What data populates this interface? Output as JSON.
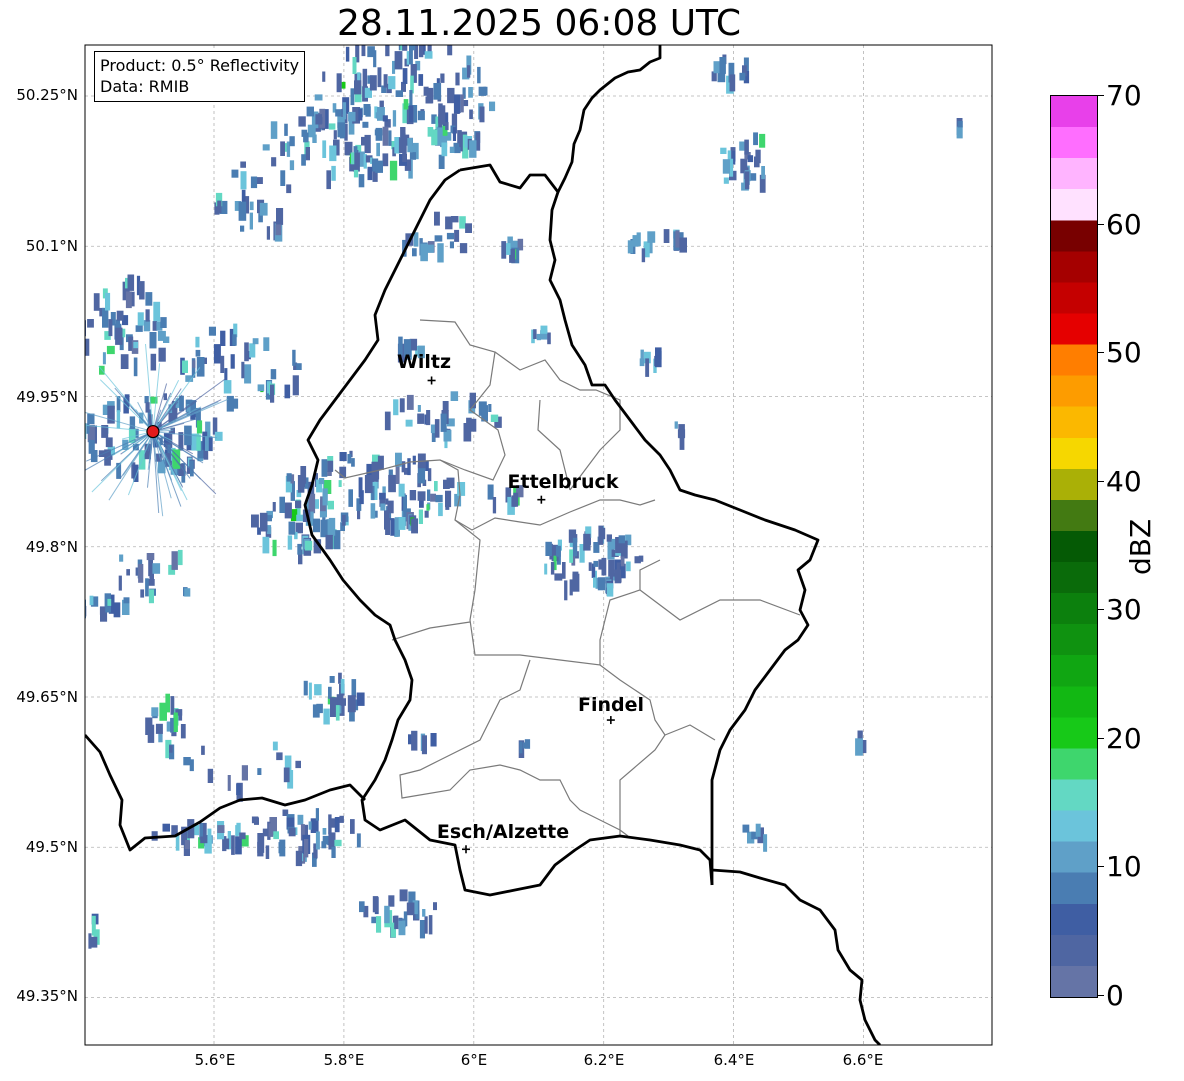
{
  "title": "28.11.2025 06:08 UTC",
  "info": {
    "product": "Product: 0.5° Reflectivity",
    "data": "Data: RMIB"
  },
  "lat_ticks": [
    "50.25°N",
    "50.1°N",
    "49.95°N",
    "49.8°N",
    "49.65°N",
    "49.5°N",
    "49.35°N"
  ],
  "lon_ticks": [
    "5.6°E",
    "5.8°E",
    "6°E",
    "6.2°E",
    "6.4°E",
    "6.6°E"
  ],
  "cities": [
    {
      "name": "Wiltz",
      "lon": 5.935,
      "lat": 49.966
    },
    {
      "name": "Ettelbruck",
      "lon": 6.104,
      "lat": 49.847
    },
    {
      "name": "Findel",
      "lon": 6.211,
      "lat": 49.627
    },
    {
      "name": "Esch/Alzette",
      "lon": 5.988,
      "lat": 49.498
    }
  ],
  "radar_site": {
    "lon": 5.506,
    "lat": 49.915,
    "color": "#e31a1c"
  },
  "colorbar": {
    "label": "dBZ",
    "ticks": [
      "0",
      "10",
      "20",
      "30",
      "40",
      "50",
      "60",
      "70"
    ],
    "min": 0,
    "max": 70,
    "colors": [
      "#6574a6",
      "#4f66a2",
      "#3f5ea3",
      "#4a7db2",
      "#5fa0c8",
      "#6bc4db",
      "#63d8c3",
      "#3ed66d",
      "#17c918",
      "#12b813",
      "#10a612",
      "#0f9210",
      "#0c800d",
      "#0a6b0a",
      "#055a05",
      "#437a12",
      "#aab006",
      "#f6d700",
      "#fbb800",
      "#fd9c00",
      "#ff7e00",
      "#e50000",
      "#c50000",
      "#a50000",
      "#780000",
      "#ffe1ff",
      "#ffb4ff",
      "#ff6eff",
      "#e840ea"
    ]
  },
  "axes": {
    "lon_range": [
      5.4,
      6.8
    ],
    "lat_range": [
      49.3,
      50.3
    ],
    "grid": true
  }
}
